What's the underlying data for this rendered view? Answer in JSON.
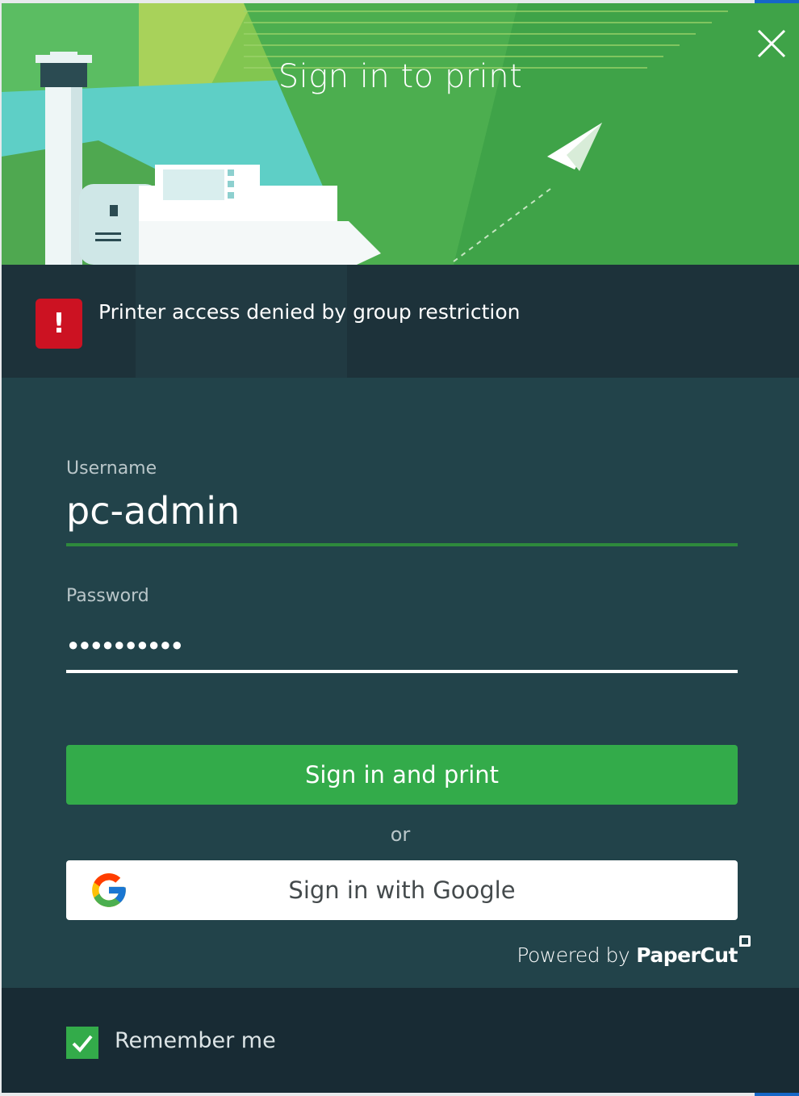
{
  "dialog": {
    "title": "Sign in to print",
    "error_message": "Printer access denied by group restriction",
    "error_icon": "!"
  },
  "form": {
    "username_label": "Username",
    "username_value": "pc-admin",
    "password_label": "Password",
    "password_masked": "●●●●●●●●●●",
    "sign_in_button": "Sign in and print",
    "or_text": "or",
    "google_button": "Sign in with Google"
  },
  "branding": {
    "powered_by": "Powered by",
    "brand": "PaperCut"
  },
  "footer": {
    "remember_me_label": "Remember me",
    "remember_me_checked": true
  },
  "colors": {
    "accent_green": "#33ab4a",
    "panel": "#22434a",
    "error_red": "#cc1222"
  },
  "icons": [
    "close-icon",
    "error-icon",
    "google-icon",
    "check-icon",
    "paper-plane-icon"
  ]
}
